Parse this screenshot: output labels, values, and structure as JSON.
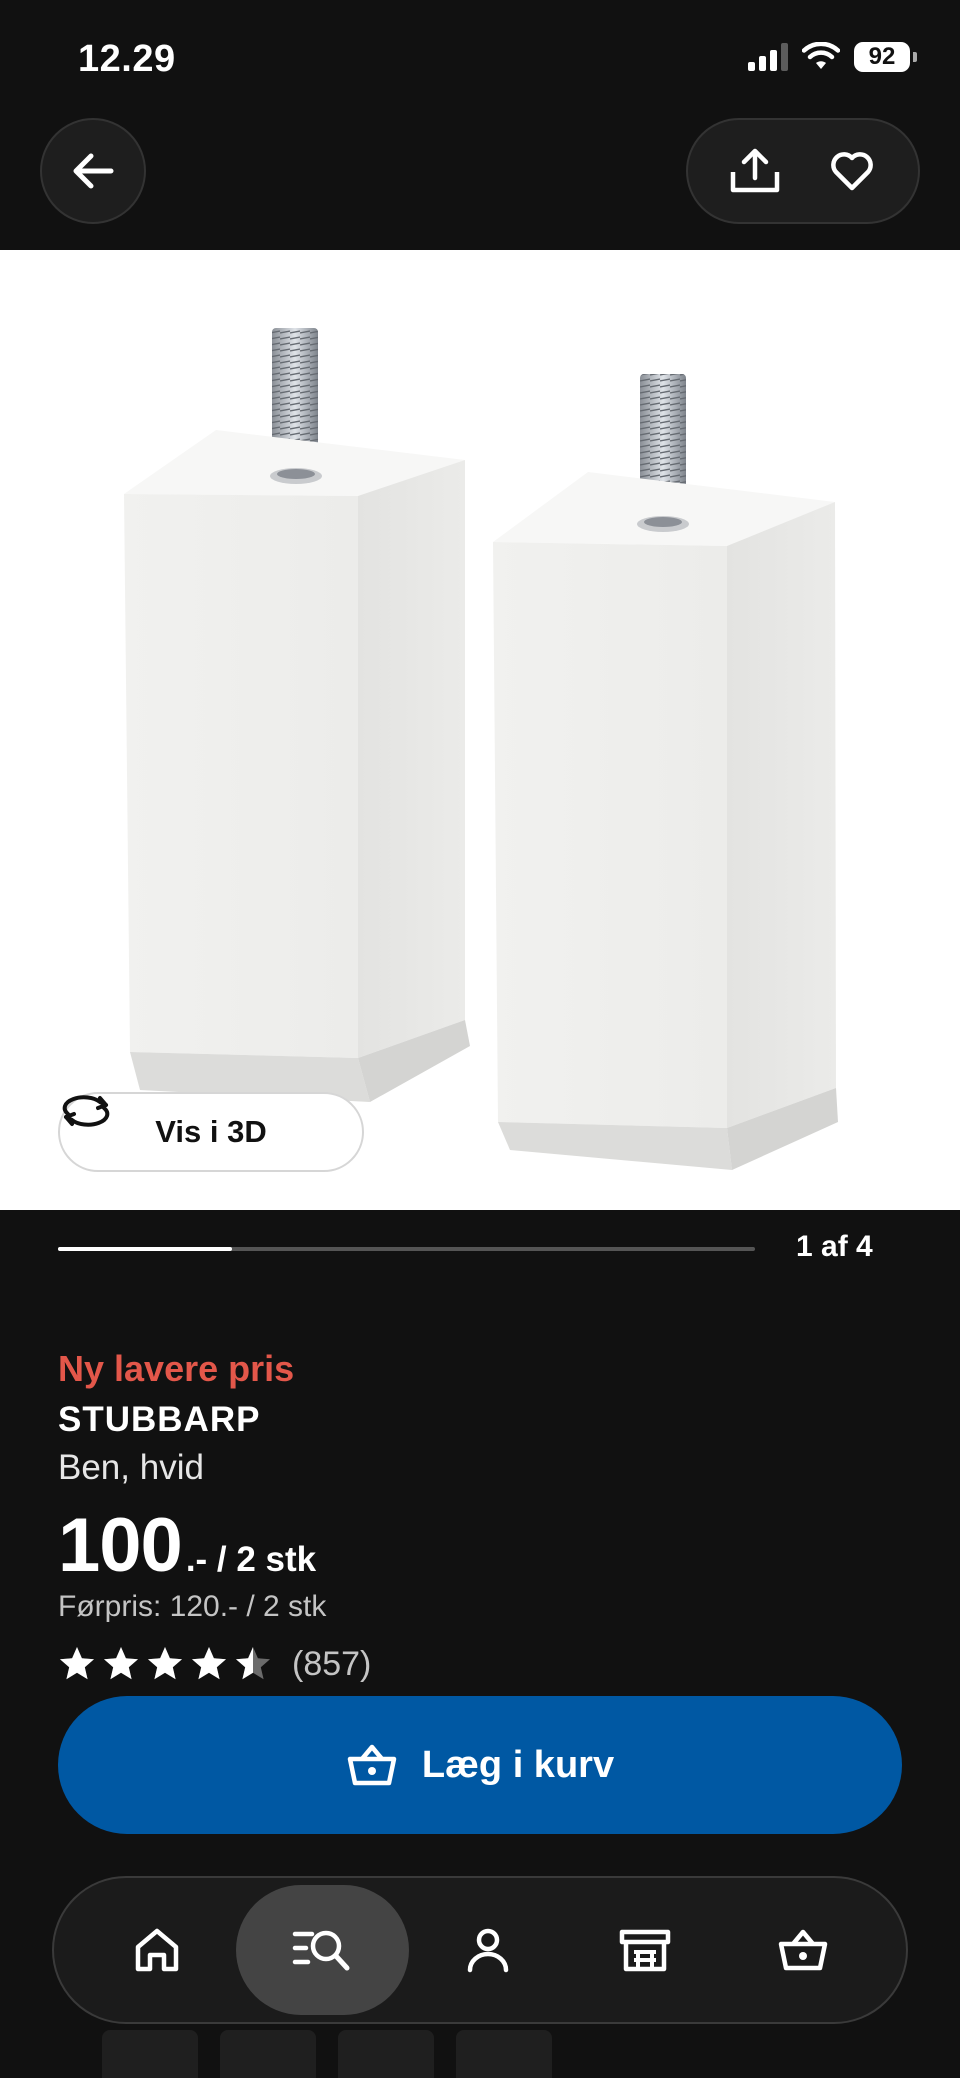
{
  "status_bar": {
    "time": "12.29",
    "battery": "92"
  },
  "top_bar": {
    "back_icon": "arrow-left-icon",
    "share_icon": "share-icon",
    "favorite_icon": "heart-icon"
  },
  "gallery": {
    "view_3d_label": "Vis i 3D",
    "view_3d_icon": "rotate-3d-icon",
    "current_image": 1,
    "total_images": 4,
    "counter_label": "1 af 4"
  },
  "product": {
    "promo_label": "Ny lavere pris",
    "name": "STUBBARP",
    "description": "Ben, hvid",
    "price": "100",
    "price_suffix": ".- / 2 stk",
    "previous_price": "Førpris: 120.- / 2 stk",
    "rating_value": 4.5,
    "rating_max": 5,
    "review_count": "(857)"
  },
  "cart_button": {
    "label": "Læg i kurv",
    "icon": "basket-icon"
  },
  "bottom_nav": {
    "items": [
      {
        "name": "home",
        "icon": "home-icon",
        "active": false
      },
      {
        "name": "search",
        "icon": "search-list-icon",
        "active": true
      },
      {
        "name": "profile",
        "icon": "person-icon",
        "active": false
      },
      {
        "name": "store",
        "icon": "store-icon",
        "active": false
      },
      {
        "name": "basket",
        "icon": "basket-icon",
        "active": false
      }
    ]
  },
  "colors": {
    "background": "#111111",
    "promo": "#e3574a",
    "primary_button": "#0058a3"
  }
}
